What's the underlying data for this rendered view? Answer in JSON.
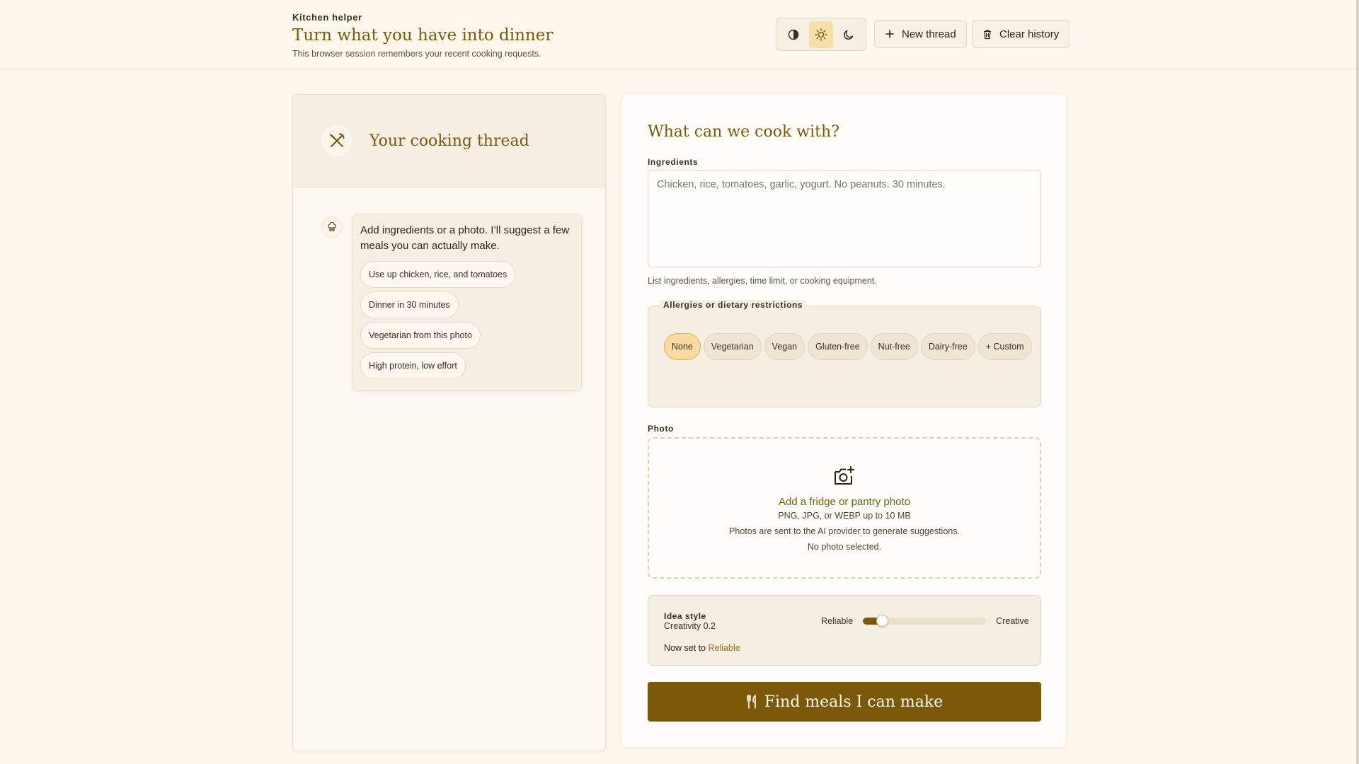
{
  "header": {
    "kicker": "Kitchen helper",
    "title": "Turn what you have into dinner",
    "subtitle": "This browser session remembers your recent cooking requests.",
    "theme_options": [
      "auto-contrast-icon",
      "sun-icon",
      "moon-icon"
    ],
    "active_theme": "light",
    "new_thread_label": "New thread",
    "clear_history_label": "Clear history"
  },
  "thread": {
    "title": "Your cooking thread",
    "message": "Add ingredients or a photo. I’ll suggest a few meals you can actually make.",
    "suggestions": [
      "Use up chicken, rice, and tomatoes",
      "Dinner in 30 minutes",
      "Vegetarian from this photo",
      "High protein, low effort"
    ]
  },
  "form": {
    "title": "What can we cook with?",
    "ingredients_label": "Ingredients",
    "ingredients_value": "",
    "ingredients_placeholder": "Chicken, rice, tomatoes, garlic, yogurt. No peanuts. 30 minutes.",
    "ingredients_hint": "List ingredients, allergies, time limit, or cooking equipment.",
    "diet_label": "Allergies or dietary restrictions",
    "diet_options": [
      "None",
      "Vegetarian",
      "Vegan",
      "Gluten-free",
      "Nut-free",
      "Dairy-free",
      "+ Custom"
    ],
    "diet_selected": "None",
    "photo_label": "Photo",
    "photo_title": "Add a fridge or pantry photo",
    "photo_formats": "PNG, JPG, or WEBP up to 10 MB",
    "photo_notice": "Photos are sent to the AI provider to generate suggestions.",
    "photo_status": "No photo selected.",
    "style_label": "Idea style",
    "style_value": "Creativity 0.2",
    "style_min_label": "Reliable",
    "style_max_label": "Creative",
    "creativity": 0.2,
    "now_set_prefix": "Now set to",
    "now_set_value": "Reliable",
    "submit_label": "Find meals I can make"
  },
  "colors": {
    "accent": "#7a5a08",
    "background": "#fdf7ee",
    "active_chip": "#f8dba1"
  }
}
